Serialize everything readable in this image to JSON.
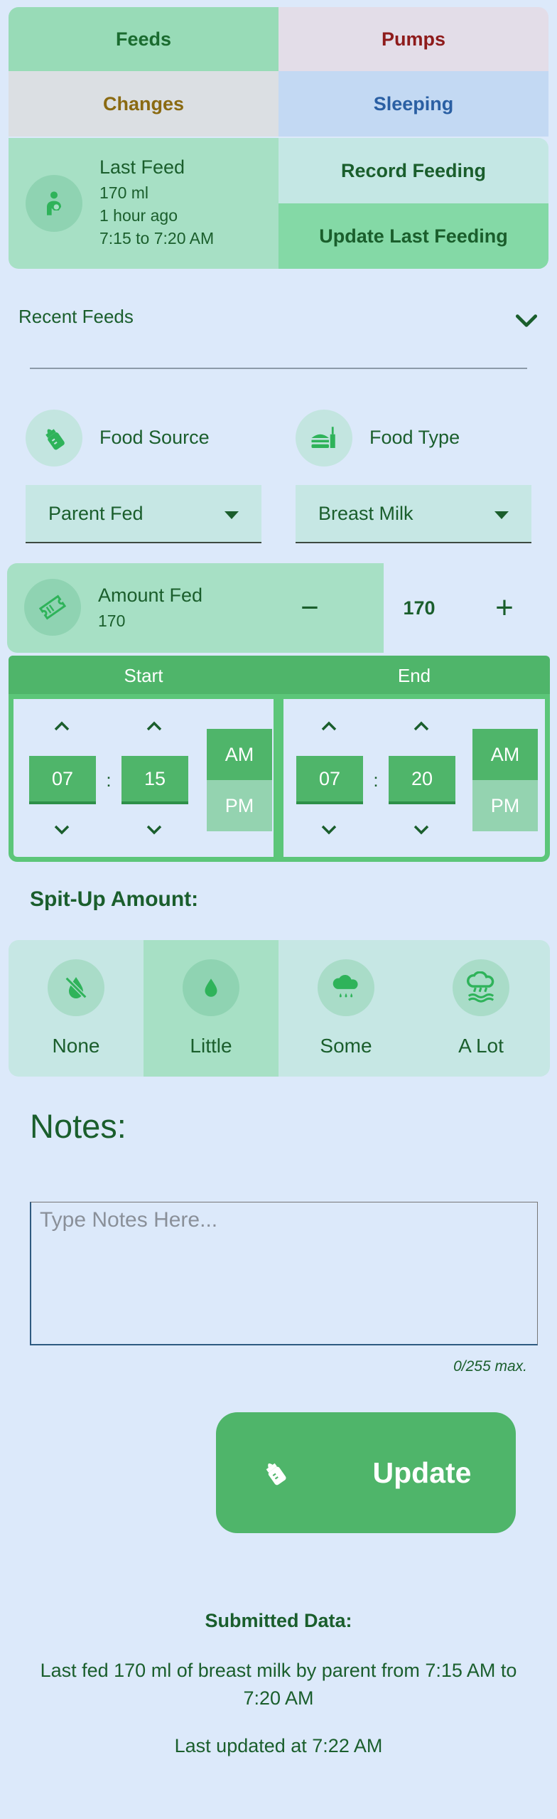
{
  "tabs": [
    {
      "label": "Feeds",
      "color": "#1a6b2f",
      "bg": "#98dbb7"
    },
    {
      "label": "Pumps",
      "color": "#8e1b1b",
      "bg": "#e3dde8"
    },
    {
      "label": "Changes",
      "color": "#8a6a12",
      "bg": "#dbdfe3"
    },
    {
      "label": "Sleeping",
      "color": "#2a5fa3",
      "bg": "#c3d9f3"
    }
  ],
  "last_feed": {
    "icon": "breastfeeding-icon",
    "title": "Last Feed",
    "amount": "170 ml",
    "ago": "1 hour ago",
    "range": "7:15 to 7:20 AM"
  },
  "actions": {
    "record": "Record Feeding",
    "update_last": "Update Last Feeding"
  },
  "recent_feeds": {
    "label": "Recent Feeds",
    "icon": "chevron-down-icon"
  },
  "food_source": {
    "label": "Food Source",
    "icon": "bottle-icon",
    "selected": "Parent Fed"
  },
  "food_type": {
    "label": "Food Type",
    "icon": "fastfood-icon",
    "selected": "Breast Milk"
  },
  "amount_fed": {
    "label": "Amount Fed",
    "icon": "ticket-icon",
    "sub": "170",
    "minus": "−",
    "value": "170",
    "plus": "+"
  },
  "time": {
    "start_label": "Start",
    "end_label": "End",
    "start": {
      "hour": "07",
      "minute": "15",
      "am": "AM",
      "pm": "PM",
      "selected": "AM"
    },
    "end": {
      "hour": "07",
      "minute": "20",
      "am": "AM",
      "pm": "PM",
      "selected": "AM"
    },
    "separator": ":"
  },
  "spit_up": {
    "label": "Spit-Up Amount:",
    "options": [
      {
        "label": "None",
        "icon": "no-drop-icon"
      },
      {
        "label": "Little",
        "icon": "drop-icon"
      },
      {
        "label": "Some",
        "icon": "cloud-rain-icon"
      },
      {
        "label": "A Lot",
        "icon": "heavy-rain-icon"
      }
    ],
    "selected": "Little"
  },
  "notes": {
    "title": "Notes:",
    "placeholder": "Type Notes Here...",
    "counter": "0/255 max."
  },
  "update_button": {
    "label": "Update",
    "icon": "bottle-icon"
  },
  "submitted": {
    "title": "Submitted Data:",
    "text": "Last fed 170 ml of breast milk by parent from 7:15 AM to 7:20 AM",
    "updated": "Last updated at 7:22 AM"
  },
  "colors": {
    "accent_green": "#4fb56a",
    "text_green": "#1a5e2c",
    "background": "#dce9fa"
  }
}
